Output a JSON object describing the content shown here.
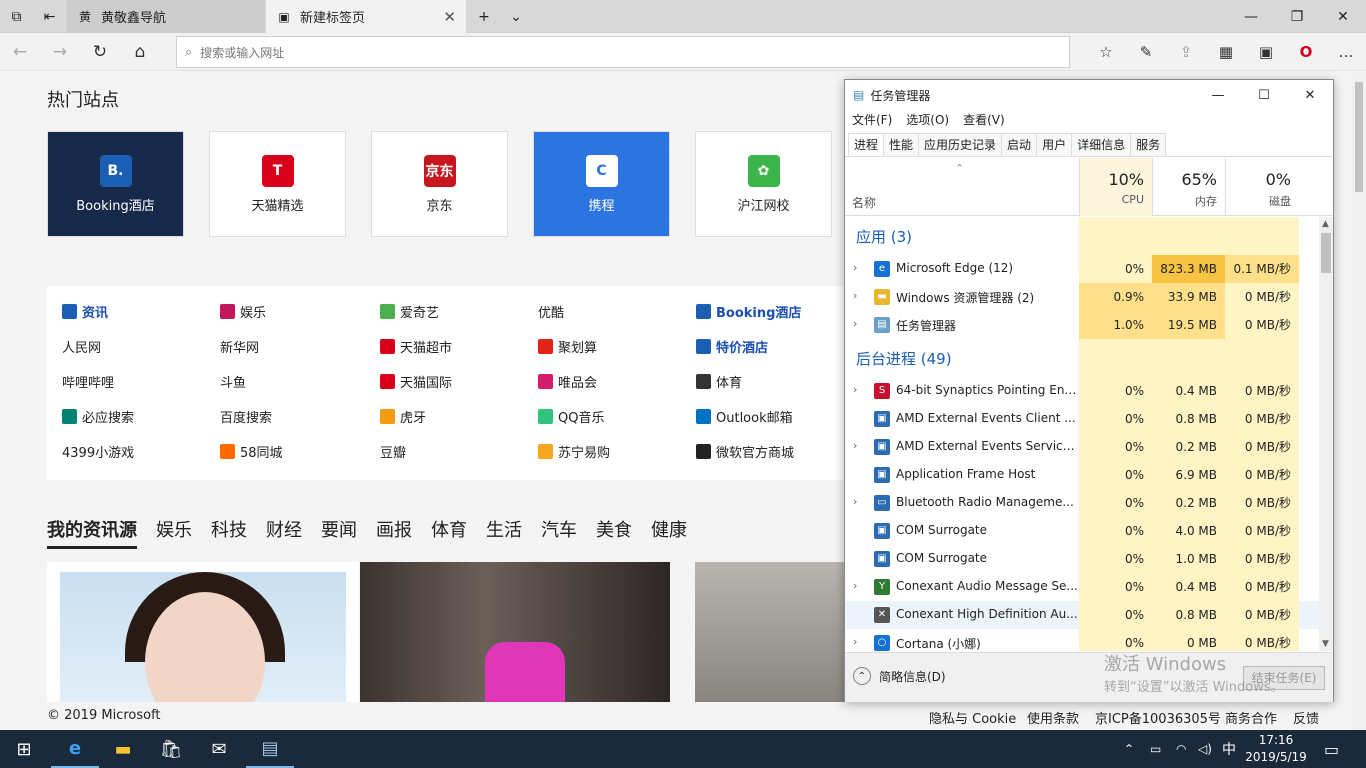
{
  "browser": {
    "tabs": [
      {
        "label": "黄敬鑫导航",
        "icon": "黄"
      },
      {
        "label": "新建标签页"
      }
    ],
    "search_placeholder": "搜索或输入网址"
  },
  "hot_sites": {
    "title": "热门站点",
    "tiles": [
      {
        "label": "Booking酒店",
        "icon": "B.",
        "bg": "#17294b",
        "icon_bg": "#1b5fb5",
        "text_color": "#ffffff"
      },
      {
        "label": "天猫精选",
        "icon": "T",
        "bg": "#ffffff",
        "icon_bg": "#d9001b",
        "text_color": "#222222"
      },
      {
        "label": "京东",
        "icon": "京东",
        "bg": "#ffffff",
        "icon_bg": "#c8161e",
        "text_color": "#222222"
      },
      {
        "label": "携程",
        "icon": "C",
        "bg": "#2c74e0",
        "icon_bg": "#ffffff",
        "text_color": "#ffffff"
      },
      {
        "label": "沪江网校",
        "icon": "✿",
        "bg": "#ffffff",
        "icon_bg": "#3bb54a",
        "text_color": "#222222"
      }
    ]
  },
  "quick_links": [
    [
      "资讯",
      "娱乐",
      "爱奇艺",
      "优酷",
      "Booking酒店"
    ],
    [
      "人民网",
      "新华网",
      "天猫超市",
      "聚划算",
      "特价酒店"
    ],
    [
      "哔哩哔哩",
      "斗鱼",
      "天猫国际",
      "唯品会",
      "体育"
    ],
    [
      "必应搜索",
      "百度搜索",
      "虎牙",
      "QQ音乐",
      "Outlook邮箱"
    ],
    [
      "4399小游戏",
      "58同城",
      "豆瓣",
      "苏宁易购",
      "微软官方商城"
    ]
  ],
  "news": {
    "categories": [
      "我的资讯源",
      "娱乐",
      "科技",
      "财经",
      "要闻",
      "画报",
      "体育",
      "生活",
      "汽车",
      "美食",
      "健康"
    ]
  },
  "footer": {
    "copyright": "© 2019 Microsoft",
    "links": [
      "隐私与 Cookie",
      "使用条款",
      "京ICP备10036305号",
      "商务合作",
      "反馈"
    ]
  },
  "task_manager": {
    "title": "任务管理器",
    "menu": [
      "文件(F)",
      "选项(O)",
      "查看(V)"
    ],
    "tabs": [
      "进程",
      "性能",
      "应用历史记录",
      "启动",
      "用户",
      "详细信息",
      "服务"
    ],
    "name_header": "名称",
    "columns": [
      {
        "pct": "10%",
        "label": "CPU"
      },
      {
        "pct": "65%",
        "label": "内存"
      },
      {
        "pct": "0%",
        "label": "磁盘"
      }
    ],
    "apps_header": "应用 (3)",
    "apps": [
      {
        "name": "Microsoft Edge (12)",
        "cpu": "0%",
        "mem": "823.3 MB",
        "disk": "0.1 MB/秒",
        "icon": "e",
        "icon_bg": "#1572d3"
      },
      {
        "name": "Windows 资源管理器 (2)",
        "cpu": "0.9%",
        "mem": "33.9 MB",
        "disk": "0 MB/秒",
        "icon": "▬",
        "icon_bg": "#e8b730"
      },
      {
        "name": "任务管理器",
        "cpu": "1.0%",
        "mem": "19.5 MB",
        "disk": "0 MB/秒",
        "icon": "▤",
        "icon_bg": "#6aa0c7"
      }
    ],
    "background_header": "后台进程 (49)",
    "background": [
      {
        "name": "64-bit Synaptics Pointing Enh...",
        "cpu": "0%",
        "mem": "0.4 MB",
        "disk": "0 MB/秒",
        "icon": "S",
        "icon_bg": "#c8102e",
        "exp": true
      },
      {
        "name": "AMD External Events Client ...",
        "cpu": "0%",
        "mem": "0.8 MB",
        "disk": "0 MB/秒",
        "icon": "▣",
        "icon_bg": "#2b6cb0",
        "exp": false
      },
      {
        "name": "AMD External Events Service...",
        "cpu": "0%",
        "mem": "0.2 MB",
        "disk": "0 MB/秒",
        "icon": "▣",
        "icon_bg": "#2b6cb0",
        "exp": true
      },
      {
        "name": "Application Frame Host",
        "cpu": "0%",
        "mem": "6.9 MB",
        "disk": "0 MB/秒",
        "icon": "▣",
        "icon_bg": "#2b6cb0",
        "exp": false
      },
      {
        "name": "Bluetooth Radio Manageme...",
        "cpu": "0%",
        "mem": "0.2 MB",
        "disk": "0 MB/秒",
        "icon": "▭",
        "icon_bg": "#2b6cb0",
        "exp": true
      },
      {
        "name": "COM Surrogate",
        "cpu": "0%",
        "mem": "4.0 MB",
        "disk": "0 MB/秒",
        "icon": "▣",
        "icon_bg": "#2b6cb0",
        "exp": false
      },
      {
        "name": "COM Surrogate",
        "cpu": "0%",
        "mem": "1.0 MB",
        "disk": "0 MB/秒",
        "icon": "▣",
        "icon_bg": "#2b6cb0",
        "exp": false
      },
      {
        "name": "Conexant Audio Message Se...",
        "cpu": "0%",
        "mem": "0.4 MB",
        "disk": "0 MB/秒",
        "icon": "Y",
        "icon_bg": "#2e7d32",
        "exp": true
      },
      {
        "name": "Conexant High Definition Au...",
        "cpu": "0%",
        "mem": "0.8 MB",
        "disk": "0 MB/秒",
        "icon": "✕",
        "icon_bg": "#555555",
        "exp": false
      },
      {
        "name": "Cortana (小娜)",
        "cpu": "0%",
        "mem": "0 MB",
        "disk": "0 MB/秒",
        "icon": "○",
        "icon_bg": "#1572d3",
        "exp": true
      }
    ],
    "fewer_details": "简略信息(D)",
    "end_task": "结束任务(E)"
  },
  "watermark": {
    "line1": "激活 Windows",
    "line2": "转到“设置”以激活 Windows。"
  },
  "taskbar": {
    "ime": "中",
    "time": "17:16",
    "date": "2019/5/19"
  },
  "colors": {
    "heat_light": "#fff4c4",
    "heat_medium": "#ffe08a",
    "heat_strong": "#f6c342",
    "accent": "#1a5fb4"
  }
}
